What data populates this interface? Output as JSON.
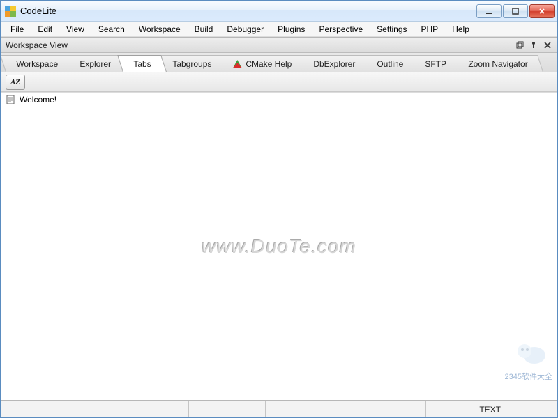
{
  "window": {
    "title": "CodeLite"
  },
  "menubar": {
    "items": [
      "File",
      "Edit",
      "View",
      "Search",
      "Workspace",
      "Build",
      "Debugger",
      "Plugins",
      "Perspective",
      "Settings",
      "PHP",
      "Help"
    ]
  },
  "panel": {
    "title": "Workspace View"
  },
  "tabs": {
    "items": [
      {
        "label": "Workspace",
        "active": false
      },
      {
        "label": "Explorer",
        "active": false
      },
      {
        "label": "Tabs",
        "active": true
      },
      {
        "label": "Tabgroups",
        "active": false
      },
      {
        "label": "CMake Help",
        "active": false,
        "icon": "cmake"
      },
      {
        "label": "DbExplorer",
        "active": false
      },
      {
        "label": "Outline",
        "active": false
      },
      {
        "label": "SFTP",
        "active": false
      },
      {
        "label": "Zoom Navigator",
        "active": false
      }
    ]
  },
  "toolbar": {
    "sort_label": "AZ"
  },
  "content": {
    "list": [
      {
        "label": "Welcome!"
      }
    ],
    "watermark": "www.DuoTe.com"
  },
  "statusbar": {
    "cells": [
      "",
      "",
      "",
      "",
      "",
      "",
      "TEXT",
      ""
    ],
    "widths": [
      160,
      110,
      110,
      110,
      50,
      70,
      120,
      70
    ]
  },
  "corner": {
    "site_badge": "2345软件大全"
  }
}
